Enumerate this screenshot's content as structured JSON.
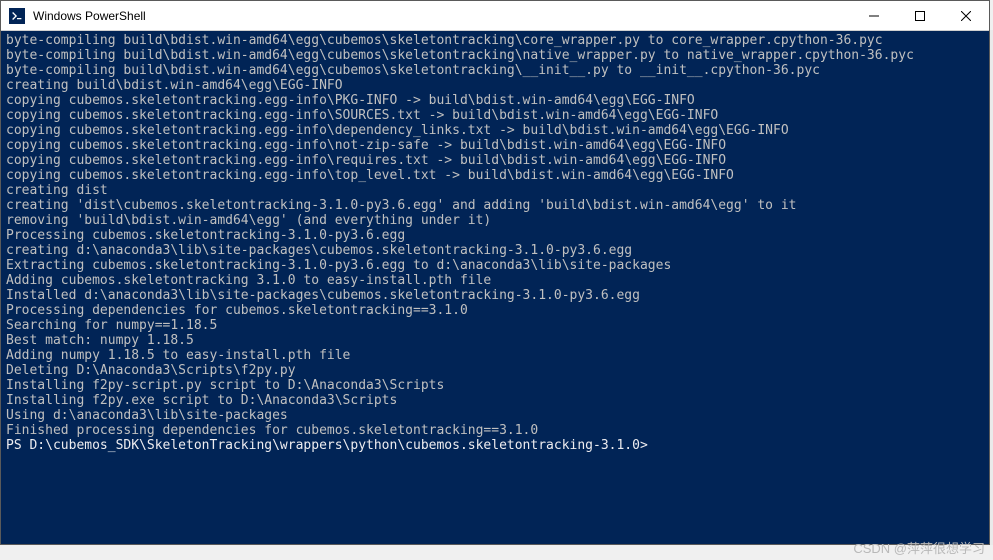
{
  "window": {
    "title": "Windows PowerShell",
    "icon_label": "PS"
  },
  "terminal": {
    "lines": [
      "byte-compiling build\\bdist.win-amd64\\egg\\cubemos\\skeletontracking\\core_wrapper.py to core_wrapper.cpython-36.pyc",
      "byte-compiling build\\bdist.win-amd64\\egg\\cubemos\\skeletontracking\\native_wrapper.py to native_wrapper.cpython-36.pyc",
      "byte-compiling build\\bdist.win-amd64\\egg\\cubemos\\skeletontracking\\__init__.py to __init__.cpython-36.pyc",
      "creating build\\bdist.win-amd64\\egg\\EGG-INFO",
      "copying cubemos.skeletontracking.egg-info\\PKG-INFO -> build\\bdist.win-amd64\\egg\\EGG-INFO",
      "copying cubemos.skeletontracking.egg-info\\SOURCES.txt -> build\\bdist.win-amd64\\egg\\EGG-INFO",
      "copying cubemos.skeletontracking.egg-info\\dependency_links.txt -> build\\bdist.win-amd64\\egg\\EGG-INFO",
      "copying cubemos.skeletontracking.egg-info\\not-zip-safe -> build\\bdist.win-amd64\\egg\\EGG-INFO",
      "copying cubemos.skeletontracking.egg-info\\requires.txt -> build\\bdist.win-amd64\\egg\\EGG-INFO",
      "copying cubemos.skeletontracking.egg-info\\top_level.txt -> build\\bdist.win-amd64\\egg\\EGG-INFO",
      "creating dist",
      "creating 'dist\\cubemos.skeletontracking-3.1.0-py3.6.egg' and adding 'build\\bdist.win-amd64\\egg' to it",
      "removing 'build\\bdist.win-amd64\\egg' (and everything under it)",
      "Processing cubemos.skeletontracking-3.1.0-py3.6.egg",
      "creating d:\\anaconda3\\lib\\site-packages\\cubemos.skeletontracking-3.1.0-py3.6.egg",
      "Extracting cubemos.skeletontracking-3.1.0-py3.6.egg to d:\\anaconda3\\lib\\site-packages",
      "Adding cubemos.skeletontracking 3.1.0 to easy-install.pth file",
      "",
      "Installed d:\\anaconda3\\lib\\site-packages\\cubemos.skeletontracking-3.1.0-py3.6.egg",
      "Processing dependencies for cubemos.skeletontracking==3.1.0",
      "Searching for numpy==1.18.5",
      "Best match: numpy 1.18.5",
      "Adding numpy 1.18.5 to easy-install.pth file",
      "Deleting D:\\Anaconda3\\Scripts\\f2py.py",
      "Installing f2py-script.py script to D:\\Anaconda3\\Scripts",
      "Installing f2py.exe script to D:\\Anaconda3\\Scripts",
      "",
      "Using d:\\anaconda3\\lib\\site-packages",
      "Finished processing dependencies for cubemos.skeletontracking==3.1.0"
    ],
    "prompt": "PS D:\\cubemos_SDK\\SkeletonTracking\\wrappers\\python\\cubemos.skeletontracking-3.1.0>"
  },
  "watermark": "CSDN @萍萍很想学习"
}
